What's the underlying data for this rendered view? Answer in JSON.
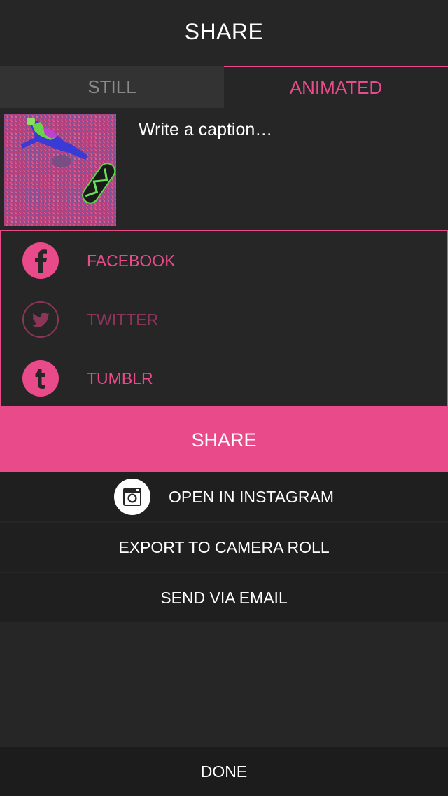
{
  "header": {
    "title": "SHARE"
  },
  "tabs": [
    {
      "label": "STILL",
      "active": false
    },
    {
      "label": "ANIMATED",
      "active": true
    }
  ],
  "compose": {
    "caption_placeholder": "Write a caption…"
  },
  "networks": [
    {
      "label": "FACEBOOK",
      "icon": "facebook-icon",
      "enabled": true
    },
    {
      "label": "TWITTER",
      "icon": "twitter-icon",
      "enabled": false
    },
    {
      "label": "TUMBLR",
      "icon": "tumblr-icon",
      "enabled": true
    }
  ],
  "share_button": {
    "label": "SHARE"
  },
  "actions": {
    "instagram": {
      "label": "OPEN IN INSTAGRAM",
      "icon": "instagram-icon"
    },
    "export": {
      "label": "EXPORT TO CAMERA ROLL"
    },
    "email": {
      "label": "SEND VIA EMAIL"
    }
  },
  "footer": {
    "done_label": "DONE"
  },
  "colors": {
    "accent": "#e84a8a",
    "accent_dim": "#8c3559",
    "background": "#262626"
  }
}
